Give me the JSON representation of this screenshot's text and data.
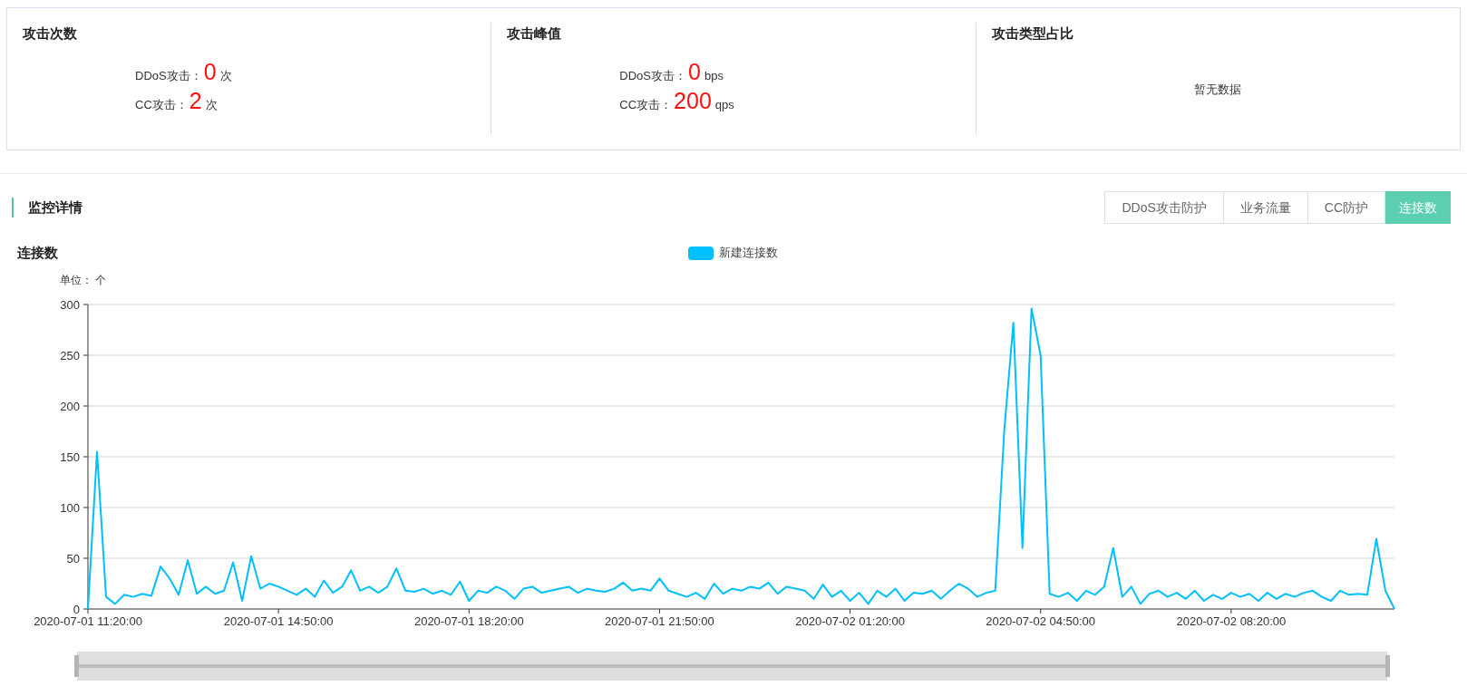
{
  "stats": [
    {
      "title": "攻击次数",
      "rows": [
        {
          "label": "DDoS攻击：",
          "value": "0",
          "unit": "次"
        },
        {
          "label": "CC攻击：",
          "value": "2",
          "unit": "次"
        }
      ]
    },
    {
      "title": "攻击峰值",
      "rows": [
        {
          "label": "DDoS攻击：",
          "value": "0",
          "unit": "bps"
        },
        {
          "label": "CC攻击：",
          "value": "200",
          "unit": "qps"
        }
      ]
    },
    {
      "title": "攻击类型占比",
      "empty_text": "暂无数据"
    }
  ],
  "section": {
    "title": "监控详情"
  },
  "tabs": [
    {
      "label": "DDoS攻击防护",
      "selected": false
    },
    {
      "label": "业务流量",
      "selected": false
    },
    {
      "label": "CC防护",
      "selected": false
    },
    {
      "label": "连接数",
      "selected": true
    }
  ],
  "chart": {
    "chart_data": {
      "type": "line",
      "title": "连接数",
      "ylabel": "单位： 个",
      "grid": true,
      "ylim": [
        0,
        300
      ],
      "yticks": [
        0,
        50,
        100,
        150,
        200,
        250,
        300
      ],
      "categories": [
        "2020-07-01 11:20:00",
        null,
        null,
        null,
        null,
        null,
        null,
        null,
        null,
        null,
        null,
        null,
        null,
        null,
        null,
        null,
        null,
        null,
        null,
        null,
        null,
        "2020-07-01 14:50:00",
        null,
        null,
        null,
        null,
        null,
        null,
        null,
        null,
        null,
        null,
        null,
        null,
        null,
        null,
        null,
        null,
        null,
        null,
        null,
        null,
        "2020-07-01 18:20:00",
        null,
        null,
        null,
        null,
        null,
        null,
        null,
        null,
        null,
        null,
        null,
        null,
        null,
        null,
        null,
        null,
        null,
        null,
        null,
        null,
        "2020-07-01 21:50:00",
        null,
        null,
        null,
        null,
        null,
        null,
        null,
        null,
        null,
        null,
        null,
        null,
        null,
        null,
        null,
        null,
        null,
        null,
        null,
        null,
        "2020-07-02 01:20:00",
        null,
        null,
        null,
        null,
        null,
        null,
        null,
        null,
        null,
        null,
        null,
        null,
        null,
        null,
        null,
        null,
        null,
        null,
        null,
        null,
        "2020-07-02 04:50:00",
        null,
        null,
        null,
        null,
        null,
        null,
        null,
        null,
        null,
        null,
        null,
        null,
        null,
        null,
        null,
        null,
        null,
        null,
        null,
        null,
        "2020-07-02 08:20:00",
        null,
        null,
        null,
        null,
        null,
        null,
        null,
        null,
        null,
        null,
        null,
        null,
        null,
        null,
        null,
        null,
        null,
        null
      ],
      "series": [
        {
          "name": "新建连接数",
          "color": "#00bfff",
          "values": [
            0,
            155,
            12,
            5,
            14,
            12,
            15,
            13,
            42,
            30,
            14,
            48,
            15,
            22,
            15,
            18,
            46,
            8,
            52,
            20,
            25,
            22,
            18,
            14,
            20,
            12,
            28,
            16,
            22,
            38,
            18,
            22,
            16,
            22,
            40,
            18,
            17,
            20,
            15,
            18,
            14,
            27,
            8,
            18,
            16,
            22,
            18,
            10,
            20,
            22,
            16,
            18,
            20,
            22,
            16,
            20,
            18,
            17,
            20,
            26,
            18,
            20,
            18,
            30,
            18,
            15,
            12,
            16,
            10,
            25,
            15,
            20,
            18,
            22,
            20,
            26,
            15,
            22,
            20,
            18,
            10,
            24,
            12,
            18,
            8,
            16,
            5,
            18,
            12,
            20,
            8,
            16,
            15,
            18,
            10,
            18,
            25,
            20,
            12,
            16,
            18,
            177,
            282,
            60,
            296,
            250,
            15,
            12,
            16,
            8,
            18,
            14,
            22,
            60,
            12,
            22,
            5,
            15,
            18,
            12,
            16,
            10,
            18,
            8,
            14,
            10,
            16,
            12,
            15,
            8,
            16,
            10,
            15,
            12,
            16,
            18,
            12,
            8,
            18,
            14,
            15,
            14,
            69,
            18,
            0
          ]
        }
      ]
    }
  }
}
